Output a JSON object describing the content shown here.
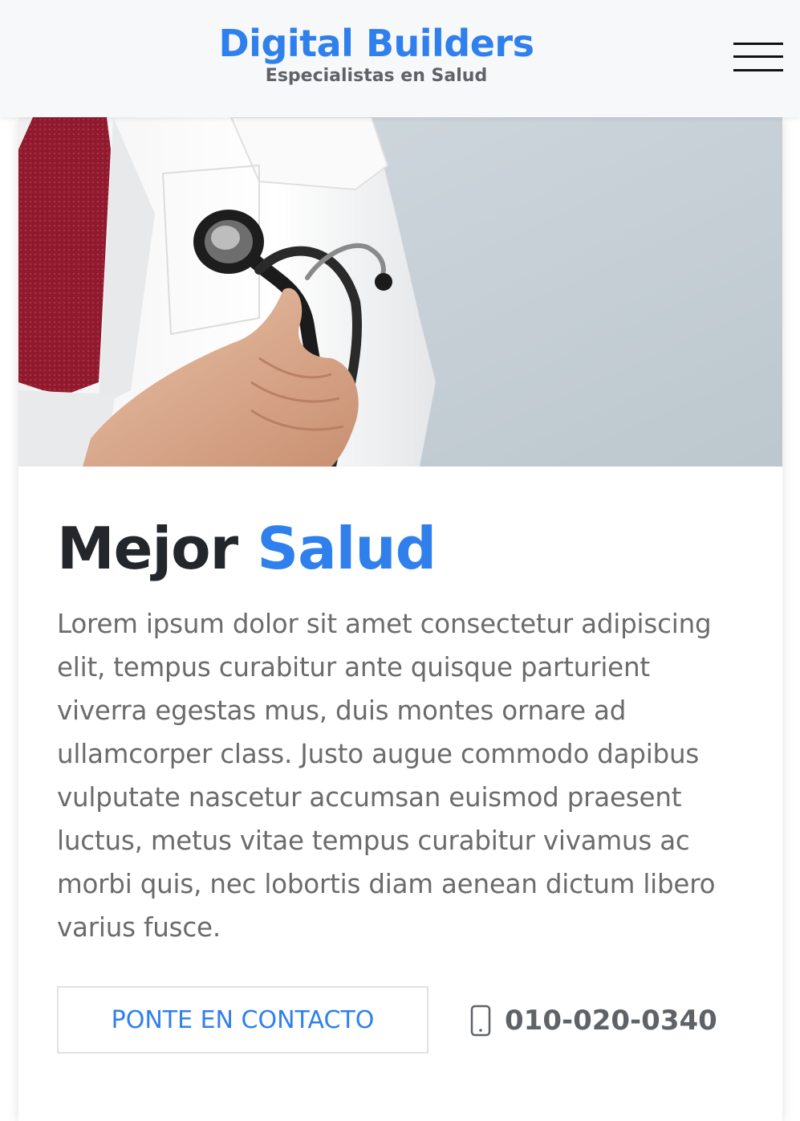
{
  "header": {
    "brand_title": "Digital Builders",
    "brand_subtitle": "Especialistas en Salud",
    "menu_icon": "hamburger-menu-icon"
  },
  "hero": {
    "image": "doctor-holding-stethoscope",
    "background_color": "#c3ccd3"
  },
  "main": {
    "headline_part1": "Mejor",
    "headline_part2": "Salud",
    "paragraph": "Lorem ipsum dolor sit amet consectetur adipiscing elit, tempus curabitur ante quisque parturient viverra egestas mus, duis montes ornare ad ullamcorper class. Justo augue commodo dapibus vulputate nascetur accumsan euismod praesent luctus, metus vitae tempus curabitur vivamus ac morbi quis, nec lobortis diam aenean dictum libero varius fusce.",
    "contact_button_label": "PONTE EN CONTACTO",
    "phone_icon": "mobile-phone-icon",
    "phone_number": "010-020-0340"
  },
  "colors": {
    "accent": "#2f80ed",
    "heading": "#23272b",
    "body_text": "#6b6b6b",
    "muted": "#5f6368",
    "header_bg": "#f7f8fa"
  }
}
